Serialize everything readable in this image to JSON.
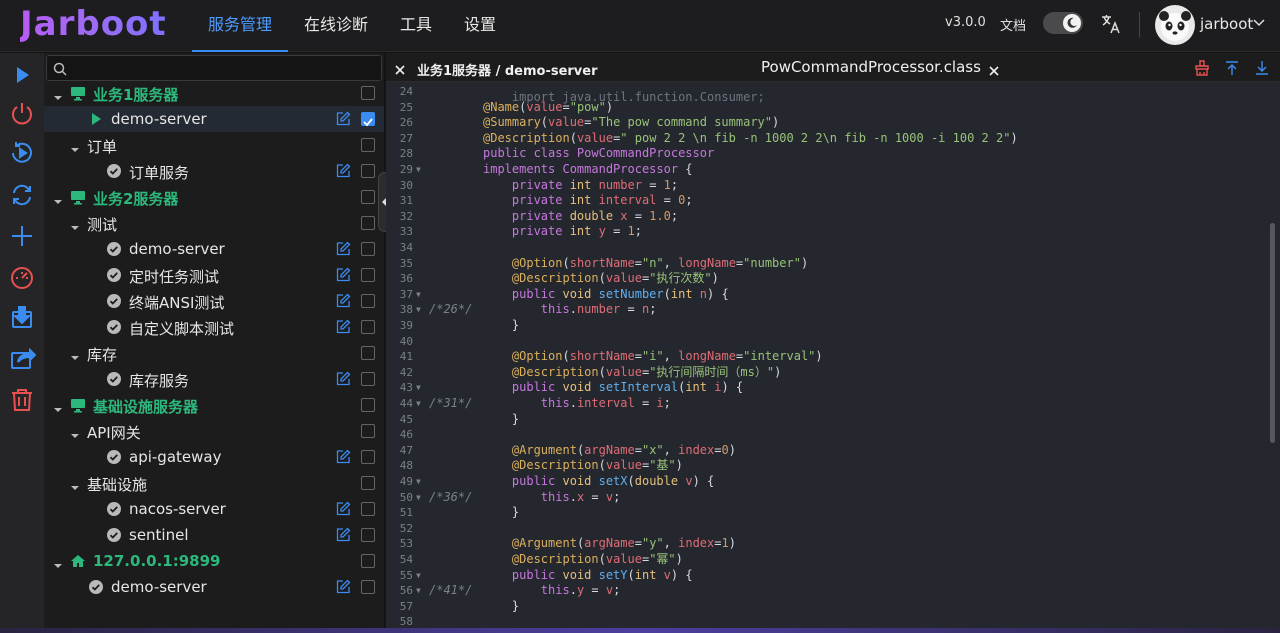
{
  "header": {
    "logo": "Jarboot",
    "nav": [
      "服务管理",
      "在线诊断",
      "工具",
      "设置"
    ],
    "version": "v3.0.0",
    "docs": "文档",
    "username": "jarboot"
  },
  "colors": {
    "accent": "#3b8cf0",
    "group": "#2cb87c",
    "danger": "#e85050"
  },
  "toolbar": {
    "icons": [
      "play-icon",
      "power-icon",
      "restart-icon",
      "refresh-icon",
      "add-icon",
      "dashboard-icon",
      "import-icon",
      "share-icon",
      "delete-icon"
    ]
  },
  "tree": {
    "search_placeholder": "",
    "rows": [
      {
        "label": "业务1服务器",
        "type": "group"
      },
      {
        "label": "demo-server",
        "type": "leaf-play",
        "selected": true,
        "checked": true
      },
      {
        "label": "订单",
        "type": "folder"
      },
      {
        "label": "订单服务",
        "type": "service"
      },
      {
        "label": "业务2服务器",
        "type": "group"
      },
      {
        "label": "测试",
        "type": "folder"
      },
      {
        "label": "demo-server",
        "type": "service"
      },
      {
        "label": "定时任务测试",
        "type": "service"
      },
      {
        "label": "终端ANSI测试",
        "type": "service"
      },
      {
        "label": "自定义脚本测试",
        "type": "service"
      },
      {
        "label": "库存",
        "type": "folder"
      },
      {
        "label": "库存服务",
        "type": "service"
      },
      {
        "label": "基础设施服务器",
        "type": "group"
      },
      {
        "label": "API网关",
        "type": "folder"
      },
      {
        "label": "api-gateway",
        "type": "service"
      },
      {
        "label": "基础设施",
        "type": "folder"
      },
      {
        "label": "nacos-server",
        "type": "service"
      },
      {
        "label": "sentinel",
        "type": "service"
      },
      {
        "label": "127.0.0.1:9899",
        "type": "host"
      },
      {
        "label": "demo-server",
        "type": "leaf-service"
      }
    ]
  },
  "editor": {
    "path": "业务1服务器 / demo-server",
    "file": "PowCommandProcessor.class",
    "lines": [
      {
        "n": "24",
        "fold": "",
        "orig": "",
        "tokens": []
      },
      {
        "n": "25",
        "fold": "",
        "orig": "",
        "tokens": [
          [
            "an",
            "@Name"
          ],
          [
            "p",
            "("
          ],
          [
            "var",
            "value"
          ],
          [
            "p",
            "="
          ],
          [
            "str",
            "\"pow\""
          ],
          [
            "p",
            ")"
          ]
        ]
      },
      {
        "n": "26",
        "fold": "",
        "orig": "",
        "tokens": [
          [
            "an",
            "@Summary"
          ],
          [
            "p",
            "("
          ],
          [
            "var",
            "value"
          ],
          [
            "p",
            "="
          ],
          [
            "str",
            "\"The pow command summary\""
          ],
          [
            "p",
            ")"
          ]
        ]
      },
      {
        "n": "27",
        "fold": "",
        "orig": "",
        "tokens": [
          [
            "an",
            "@Description"
          ],
          [
            "p",
            "("
          ],
          [
            "var",
            "value"
          ],
          [
            "p",
            "="
          ],
          [
            "str",
            "\" pow 2 2 \\n fib -n 1000 2 2\\n fib -n 1000 -i 100 2 2\""
          ],
          [
            "p",
            ")"
          ]
        ]
      },
      {
        "n": "28",
        "fold": "",
        "orig": "",
        "tokens": [
          [
            "kw",
            "public class "
          ],
          [
            "cls",
            "PowCommandProcessor"
          ]
        ]
      },
      {
        "n": "29",
        "fold": "▼",
        "orig": "",
        "tokens": [
          [
            "kw",
            "implements "
          ],
          [
            "cls",
            "CommandProcessor"
          ],
          [
            "p",
            " {"
          ]
        ]
      },
      {
        "n": "30",
        "fold": "",
        "orig": "",
        "tokens": [
          [
            "p",
            "    "
          ],
          [
            "kw",
            "private "
          ],
          [
            "ty",
            "int "
          ],
          [
            "var",
            "number"
          ],
          [
            "p",
            " = "
          ],
          [
            "num",
            "1"
          ],
          [
            "p",
            ";"
          ]
        ]
      },
      {
        "n": "31",
        "fold": "",
        "orig": "",
        "tokens": [
          [
            "p",
            "    "
          ],
          [
            "kw",
            "private "
          ],
          [
            "ty",
            "int "
          ],
          [
            "var",
            "interval"
          ],
          [
            "p",
            " = "
          ],
          [
            "num",
            "0"
          ],
          [
            "p",
            ";"
          ]
        ]
      },
      {
        "n": "32",
        "fold": "",
        "orig": "",
        "tokens": [
          [
            "p",
            "    "
          ],
          [
            "kw",
            "private "
          ],
          [
            "ty",
            "double "
          ],
          [
            "var",
            "x"
          ],
          [
            "p",
            " = "
          ],
          [
            "num",
            "1.0"
          ],
          [
            "p",
            ";"
          ]
        ]
      },
      {
        "n": "33",
        "fold": "",
        "orig": "",
        "tokens": [
          [
            "p",
            "    "
          ],
          [
            "kw",
            "private "
          ],
          [
            "ty",
            "int "
          ],
          [
            "var",
            "y"
          ],
          [
            "p",
            " = "
          ],
          [
            "num",
            "1"
          ],
          [
            "p",
            ";"
          ]
        ]
      },
      {
        "n": "34",
        "fold": "",
        "orig": "",
        "tokens": []
      },
      {
        "n": "35",
        "fold": "",
        "orig": "",
        "tokens": [
          [
            "p",
            "    "
          ],
          [
            "an",
            "@Option"
          ],
          [
            "p",
            "("
          ],
          [
            "var",
            "shortName"
          ],
          [
            "p",
            "="
          ],
          [
            "str",
            "\"n\""
          ],
          [
            "p",
            ", "
          ],
          [
            "var",
            "longName"
          ],
          [
            "p",
            "="
          ],
          [
            "str",
            "\"number\""
          ],
          [
            "p",
            ")"
          ]
        ]
      },
      {
        "n": "36",
        "fold": "",
        "orig": "",
        "tokens": [
          [
            "p",
            "    "
          ],
          [
            "an",
            "@Description"
          ],
          [
            "p",
            "("
          ],
          [
            "var",
            "value"
          ],
          [
            "p",
            "="
          ],
          [
            "str",
            "\"执行次数\""
          ],
          [
            "p",
            ")"
          ]
        ]
      },
      {
        "n": "37",
        "fold": "▼",
        "orig": "",
        "tokens": [
          [
            "p",
            "    "
          ],
          [
            "kw",
            "public "
          ],
          [
            "ty",
            "void "
          ],
          [
            "fn",
            "setNumber"
          ],
          [
            "p",
            "("
          ],
          [
            "ty",
            "int "
          ],
          [
            "var",
            "n"
          ],
          [
            "p",
            ") {"
          ]
        ]
      },
      {
        "n": "38",
        "fold": "▼",
        "orig": "/*26*/",
        "tokens": [
          [
            "p",
            "        "
          ],
          [
            "kw",
            "this"
          ],
          [
            "p",
            "."
          ],
          [
            "var",
            "number"
          ],
          [
            "p",
            " = "
          ],
          [
            "var",
            "n"
          ],
          [
            "p",
            ";"
          ]
        ]
      },
      {
        "n": "39",
        "fold": "",
        "orig": "",
        "tokens": [
          [
            "p",
            "    }"
          ]
        ]
      },
      {
        "n": "40",
        "fold": "",
        "orig": "",
        "tokens": []
      },
      {
        "n": "41",
        "fold": "",
        "orig": "",
        "tokens": [
          [
            "p",
            "    "
          ],
          [
            "an",
            "@Option"
          ],
          [
            "p",
            "("
          ],
          [
            "var",
            "shortName"
          ],
          [
            "p",
            "="
          ],
          [
            "str",
            "\"i\""
          ],
          [
            "p",
            ", "
          ],
          [
            "var",
            "longName"
          ],
          [
            "p",
            "="
          ],
          [
            "str",
            "\"interval\""
          ],
          [
            "p",
            ")"
          ]
        ]
      },
      {
        "n": "42",
        "fold": "",
        "orig": "",
        "tokens": [
          [
            "p",
            "    "
          ],
          [
            "an",
            "@Description"
          ],
          [
            "p",
            "("
          ],
          [
            "var",
            "value"
          ],
          [
            "p",
            "="
          ],
          [
            "str",
            "\"执行间隔时间（ms）\""
          ],
          [
            "p",
            ")"
          ]
        ]
      },
      {
        "n": "43",
        "fold": "▼",
        "orig": "",
        "tokens": [
          [
            "p",
            "    "
          ],
          [
            "kw",
            "public "
          ],
          [
            "ty",
            "void "
          ],
          [
            "fn",
            "setInterval"
          ],
          [
            "p",
            "("
          ],
          [
            "ty",
            "int "
          ],
          [
            "var",
            "i"
          ],
          [
            "p",
            ") {"
          ]
        ]
      },
      {
        "n": "44",
        "fold": "▼",
        "orig": "/*31*/",
        "tokens": [
          [
            "p",
            "        "
          ],
          [
            "kw",
            "this"
          ],
          [
            "p",
            "."
          ],
          [
            "var",
            "interval"
          ],
          [
            "p",
            " = "
          ],
          [
            "var",
            "i"
          ],
          [
            "p",
            ";"
          ]
        ]
      },
      {
        "n": "45",
        "fold": "",
        "orig": "",
        "tokens": [
          [
            "p",
            "    }"
          ]
        ]
      },
      {
        "n": "46",
        "fold": "",
        "orig": "",
        "tokens": []
      },
      {
        "n": "47",
        "fold": "",
        "orig": "",
        "tokens": [
          [
            "p",
            "    "
          ],
          [
            "an",
            "@Argument"
          ],
          [
            "p",
            "("
          ],
          [
            "var",
            "argName"
          ],
          [
            "p",
            "="
          ],
          [
            "str",
            "\"x\""
          ],
          [
            "p",
            ", "
          ],
          [
            "var",
            "index"
          ],
          [
            "p",
            "="
          ],
          [
            "num",
            "0"
          ],
          [
            "p",
            ")"
          ]
        ]
      },
      {
        "n": "48",
        "fold": "",
        "orig": "",
        "tokens": [
          [
            "p",
            "    "
          ],
          [
            "an",
            "@Description"
          ],
          [
            "p",
            "("
          ],
          [
            "var",
            "value"
          ],
          [
            "p",
            "="
          ],
          [
            "str",
            "\"基\""
          ],
          [
            "p",
            ")"
          ]
        ]
      },
      {
        "n": "49",
        "fold": "▼",
        "orig": "",
        "tokens": [
          [
            "p",
            "    "
          ],
          [
            "kw",
            "public "
          ],
          [
            "ty",
            "void "
          ],
          [
            "fn",
            "setX"
          ],
          [
            "p",
            "("
          ],
          [
            "ty",
            "double "
          ],
          [
            "var",
            "v"
          ],
          [
            "p",
            ") {"
          ]
        ]
      },
      {
        "n": "50",
        "fold": "▼",
        "orig": "/*36*/",
        "tokens": [
          [
            "p",
            "        "
          ],
          [
            "kw",
            "this"
          ],
          [
            "p",
            "."
          ],
          [
            "var",
            "x"
          ],
          [
            "p",
            " = "
          ],
          [
            "var",
            "v"
          ],
          [
            "p",
            ";"
          ]
        ]
      },
      {
        "n": "51",
        "fold": "",
        "orig": "",
        "tokens": [
          [
            "p",
            "    }"
          ]
        ]
      },
      {
        "n": "52",
        "fold": "",
        "orig": "",
        "tokens": []
      },
      {
        "n": "53",
        "fold": "",
        "orig": "",
        "tokens": [
          [
            "p",
            "    "
          ],
          [
            "an",
            "@Argument"
          ],
          [
            "p",
            "("
          ],
          [
            "var",
            "argName"
          ],
          [
            "p",
            "="
          ],
          [
            "str",
            "\"y\""
          ],
          [
            "p",
            ", "
          ],
          [
            "var",
            "index"
          ],
          [
            "p",
            "="
          ],
          [
            "num",
            "1"
          ],
          [
            "p",
            ")"
          ]
        ]
      },
      {
        "n": "54",
        "fold": "",
        "orig": "",
        "tokens": [
          [
            "p",
            "    "
          ],
          [
            "an",
            "@Description"
          ],
          [
            "p",
            "("
          ],
          [
            "var",
            "value"
          ],
          [
            "p",
            "="
          ],
          [
            "str",
            "\"幂\""
          ],
          [
            "p",
            ")"
          ]
        ]
      },
      {
        "n": "55",
        "fold": "▼",
        "orig": "",
        "tokens": [
          [
            "p",
            "    "
          ],
          [
            "kw",
            "public "
          ],
          [
            "ty",
            "void "
          ],
          [
            "fn",
            "setY"
          ],
          [
            "p",
            "("
          ],
          [
            "ty",
            "int "
          ],
          [
            "var",
            "v"
          ],
          [
            "p",
            ") {"
          ]
        ]
      },
      {
        "n": "56",
        "fold": "▼",
        "orig": "/*41*/",
        "tokens": [
          [
            "p",
            "        "
          ],
          [
            "kw",
            "this"
          ],
          [
            "p",
            "."
          ],
          [
            "var",
            "y"
          ],
          [
            "p",
            " = "
          ],
          [
            "var",
            "v"
          ],
          [
            "p",
            ";"
          ]
        ]
      },
      {
        "n": "57",
        "fold": "",
        "orig": "",
        "tokens": [
          [
            "p",
            "    }"
          ]
        ]
      },
      {
        "n": "58",
        "fold": "",
        "orig": "",
        "tokens": []
      }
    ]
  }
}
